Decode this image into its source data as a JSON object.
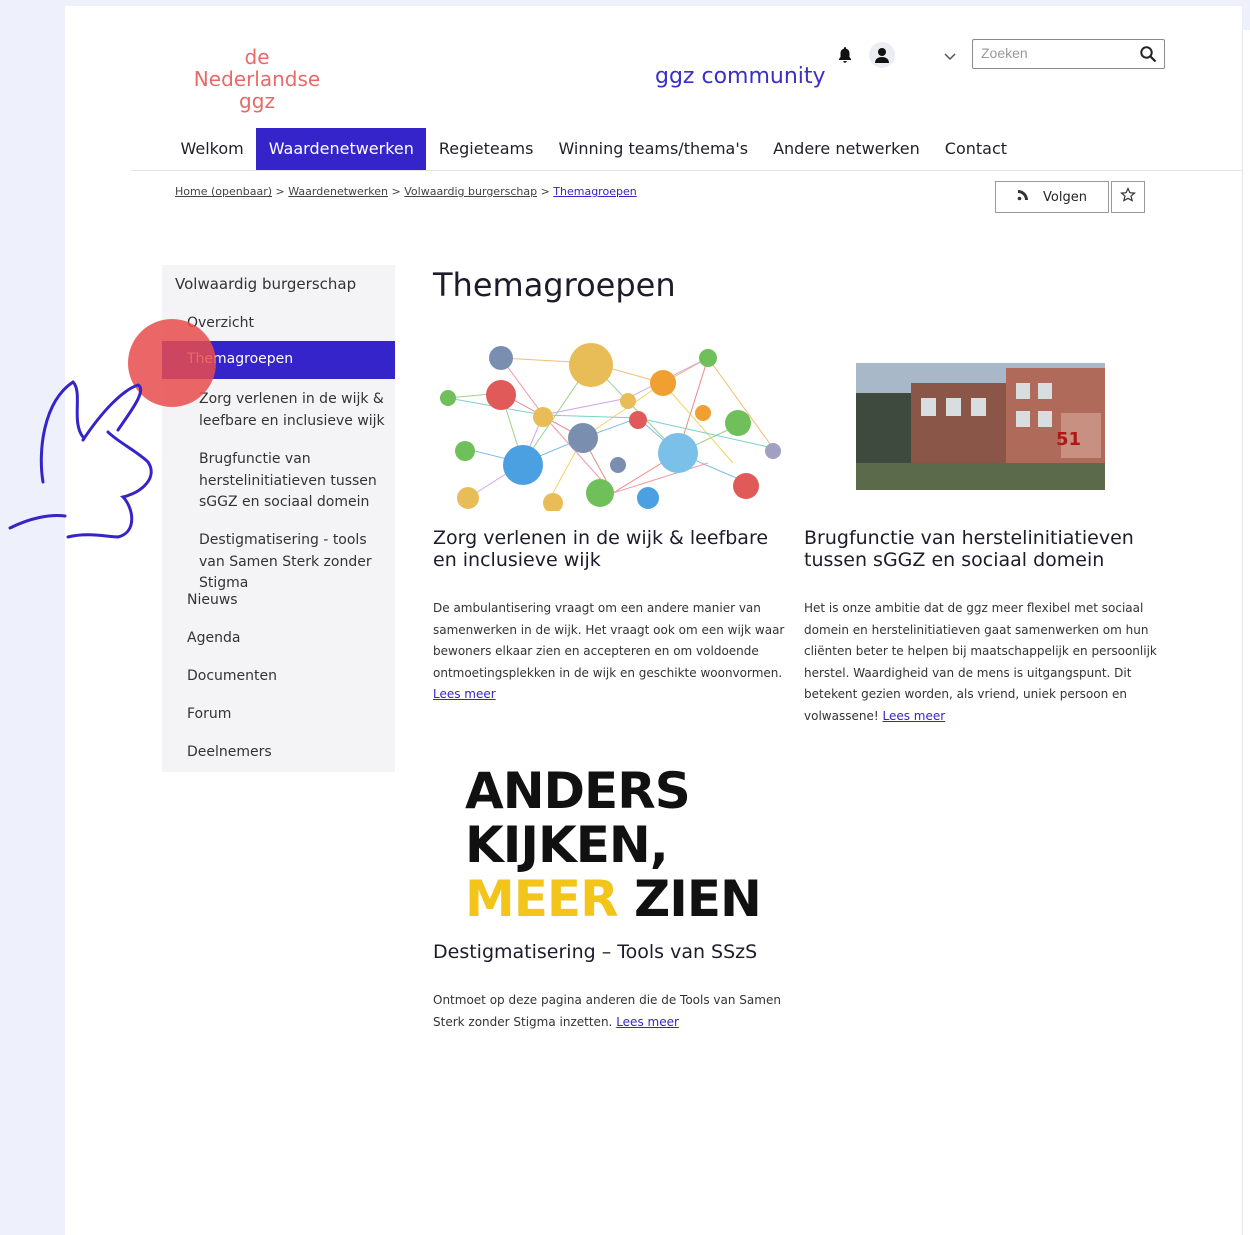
{
  "header": {
    "logo_lines": [
      "de",
      "Nederlandse",
      "ggz"
    ],
    "brand": "ggz community",
    "search_placeholder": "Zoeken"
  },
  "nav": {
    "items": [
      "Welkom",
      "Waardenetwerken",
      "Regieteams",
      "Winning teams/thema's",
      "Andere netwerken",
      "Contact"
    ],
    "active_index": 1
  },
  "breadcrumb": {
    "items": [
      "Home (openbaar)",
      "Waardenetwerken",
      "Volwaardig burgerschap",
      "Themagroepen"
    ],
    "separator": ">"
  },
  "actions": {
    "follow_label": "Volgen"
  },
  "sidebar": {
    "heading": "Volwaardig burgerschap",
    "items": {
      "overzicht": "Overzicht",
      "themagroepen": "Themagroepen",
      "sub1": "Zorg verlenen in de wijk & leefbare en inclusieve wijk",
      "sub2": "Brugfunctie van herstelinitiatieven tussen sGGZ en sociaal domein",
      "sub3": "Destigmatisering - tools van Samen Sterk zonder Stigma",
      "nieuws": "Nieuws",
      "agenda": "Agenda",
      "documenten": "Documenten",
      "forum": "Forum",
      "deelnemers": "Deelnemers"
    }
  },
  "main": {
    "title": "Themagroepen",
    "cards": [
      {
        "title": "Zorg verlenen in de wijk & leefbare en inclusieve wijk",
        "text": "De ambulantisering vraagt om een andere manier van samenwerken in de wijk. Het vraagt ook om een wijk waar bewoners elkaar zien en accepteren en om voldoende ontmoetingsplekken in de wijk en geschikte woonvormen.",
        "link": "Lees meer"
      },
      {
        "title": "Brugfunctie van herstelinitiatieven tussen sGGZ en sociaal domein",
        "text": "Het is onze ambitie dat de ggz meer flexibel met sociaal domein en herstelinitiatieven gaat samenwerken om hun cliënten beter te helpen bij maatschappelijk en persoonlijk herstel. Waardigheid van de mens is uitgangspunt. Dit betekent gezien worden, als vriend, uniek persoon en volwassene!",
        "link": "Lees meer",
        "image_number": "51"
      },
      {
        "title": "Destigmatisering – Tools van SSzS",
        "text": "Ontmoet op deze pagina anderen die de Tools van Samen Sterk zonder Stigma inzetten.",
        "link": "Lees meer",
        "image_lines": [
          "ANDERS",
          "KIJKEN,",
          "MEER",
          "ZIEN"
        ]
      }
    ]
  },
  "colors": {
    "accent": "#3524c9",
    "logo": "#e8696a",
    "highlight": "#f3c419"
  }
}
